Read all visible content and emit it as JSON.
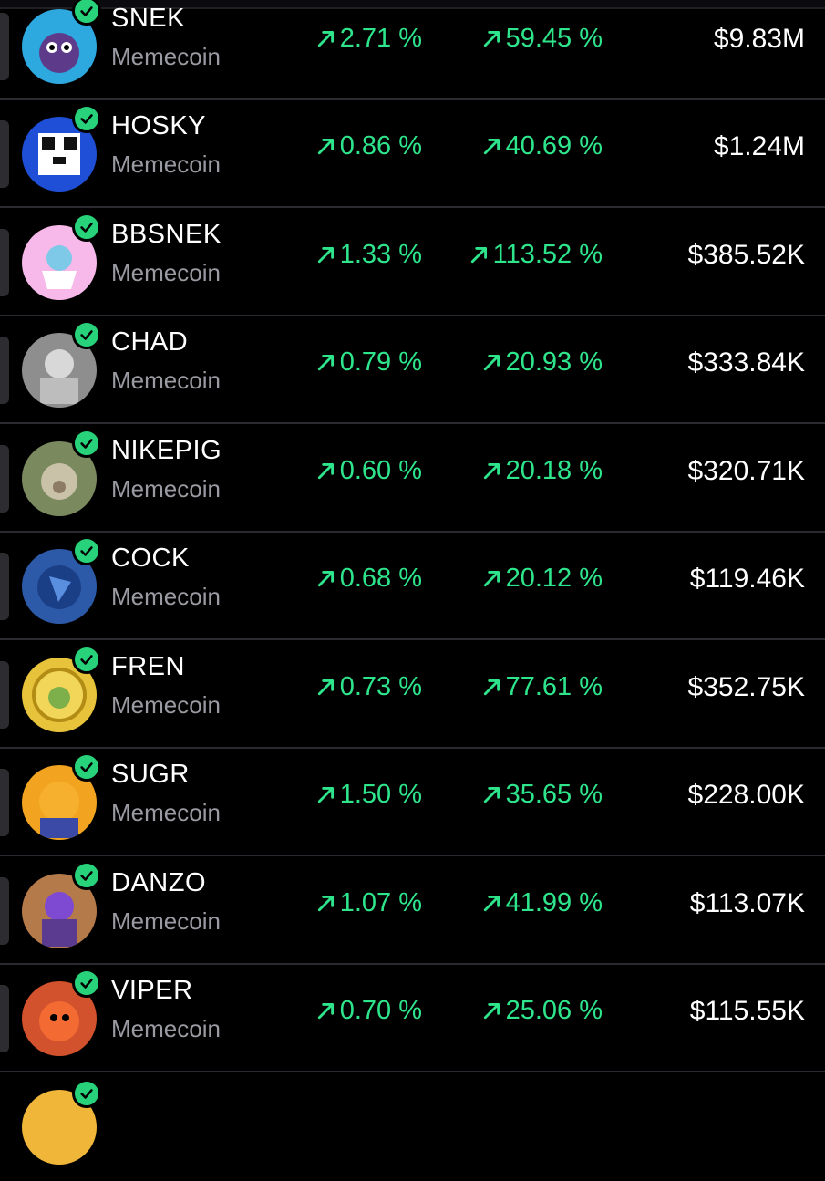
{
  "rows": [
    {
      "name": "SNEK",
      "category": "Memecoin",
      "change_a": "2.71 %",
      "change_b": "59.45 %",
      "market_cap": "$9.83M",
      "avatar_color": "#2ea9e0",
      "avatar_icon": "snake-icon"
    },
    {
      "name": "HOSKY",
      "category": "Memecoin",
      "change_a": "0.86 %",
      "change_b": "40.69 %",
      "market_cap": "$1.24M",
      "avatar_color": "#1f4fd6",
      "avatar_icon": "husky-icon"
    },
    {
      "name": "BBSNEK",
      "category": "Memecoin",
      "change_a": "1.33 %",
      "change_b": "113.52 %",
      "market_cap": "$385.52K",
      "avatar_color": "#f6b9e9",
      "avatar_icon": "baby-snake-icon"
    },
    {
      "name": "CHAD",
      "category": "Memecoin",
      "change_a": "0.79 %",
      "change_b": "20.93 %",
      "market_cap": "$333.84K",
      "avatar_color": "#8e8e8e",
      "avatar_icon": "chad-face-icon"
    },
    {
      "name": "NIKEPIG",
      "category": "Memecoin",
      "change_a": "0.60 %",
      "change_b": "20.18 %",
      "market_cap": "$320.71K",
      "avatar_color": "#7b8a5e",
      "avatar_icon": "pig-icon"
    },
    {
      "name": "COCK",
      "category": "Memecoin",
      "change_a": "0.68 %",
      "change_b": "20.12 %",
      "market_cap": "$119.46K",
      "avatar_color": "#2d5aa8",
      "avatar_icon": "rooster-icon"
    },
    {
      "name": "FREN",
      "category": "Memecoin",
      "change_a": "0.73 %",
      "change_b": "77.61 %",
      "market_cap": "$352.75K",
      "avatar_color": "#e7c33b",
      "avatar_icon": "frog-coin-icon"
    },
    {
      "name": "SUGR",
      "category": "Memecoin",
      "change_a": "1.50 %",
      "change_b": "35.65 %",
      "market_cap": "$228.00K",
      "avatar_color": "#f2a421",
      "avatar_icon": "cat-icon"
    },
    {
      "name": "DANZO",
      "category": "Memecoin",
      "change_a": "1.07 %",
      "change_b": "41.99 %",
      "market_cap": "$113.07K",
      "avatar_color": "#b57a4a",
      "avatar_icon": "character-icon"
    },
    {
      "name": "VIPER",
      "category": "Memecoin",
      "change_a": "0.70 %",
      "change_b": "25.06 %",
      "market_cap": "$115.55K",
      "avatar_color": "#d1522c",
      "avatar_icon": "viper-icon"
    }
  ],
  "colors": {
    "positive": "#2ee58c",
    "badge": "#27d27a"
  }
}
